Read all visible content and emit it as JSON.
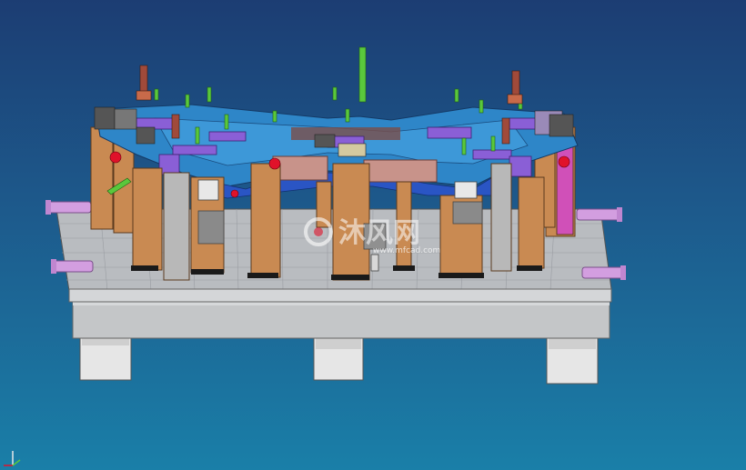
{
  "viewport": {
    "background_top": "#1c3d73",
    "background_bottom": "#1a7fa8"
  },
  "model": {
    "base_plate_color": "#b9bcc0",
    "fixture_block_color": "#c98a52",
    "part_surface_color": "#2e86c8",
    "clamp_color": "#8a5fd6",
    "pin_color": "#5ac83c",
    "handle_color": "#d39ee0",
    "sensor_ball_color": "#e0122a",
    "column_color": "#e5e5e5"
  },
  "watermark": {
    "icon": "shen-feng-logo-icon",
    "text": "沐风网",
    "url": "www.mfcad.com"
  },
  "axis_triad": {
    "icon": "axis-triad-icon"
  }
}
